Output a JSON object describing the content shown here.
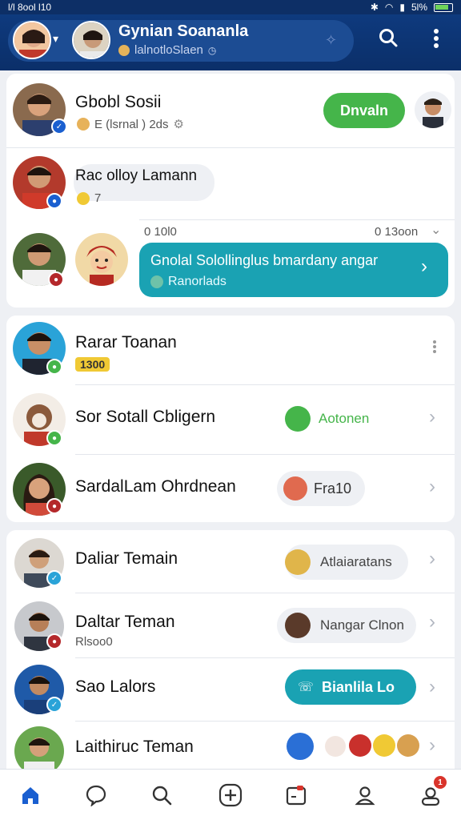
{
  "status_bar": {
    "left_text": "l/l 8ool l10",
    "battery_text": "5l%"
  },
  "header": {
    "title": "Gynian Soananla",
    "subtitle": "lalnotloSlaen",
    "colors": {
      "bar": "#0b2f69",
      "pill": "#1c4c93"
    }
  },
  "top_card": {
    "row1": {
      "name": "Gbobl Sosii",
      "subtitle": "E (lsrnal ) 2ds",
      "button_label": "Dnvaln"
    },
    "row2": {
      "name": "Rac olloy Lamann",
      "subtitle_count": "7"
    },
    "row3": {
      "left_time": "0 10l0",
      "right_time": "0 13oon",
      "message_title": "Gnolal Solollinglus bmardany angar",
      "message_subtitle": "Ranorlads"
    }
  },
  "list_card_1": [
    {
      "name": "Rarar Toanan",
      "tag": "1300"
    },
    {
      "name": "Sor Sotall Cbligern",
      "status_label": "Aotonen"
    },
    {
      "name": "SardalLam Ohrdnean",
      "status_label": "Fra10"
    }
  ],
  "list_card_2": [
    {
      "name": "Daliar Temain",
      "status_label": "Atlaiaratans"
    },
    {
      "name": "Daltar Teman",
      "subtitle": "Rlsoo0",
      "status_label": "Nangar Clnon"
    },
    {
      "name": "Sao Lalors",
      "button_label": "Bianlila Lo"
    },
    {
      "name": "Laithiruc Teman"
    }
  ],
  "nav": {
    "items": [
      "home",
      "chat",
      "search",
      "add",
      "calendar",
      "profile",
      "account"
    ],
    "notification_count": "1"
  },
  "accent_colors": {
    "green": "#45b54a",
    "teal": "#1aa2b3",
    "blue": "#1a5fd0"
  }
}
